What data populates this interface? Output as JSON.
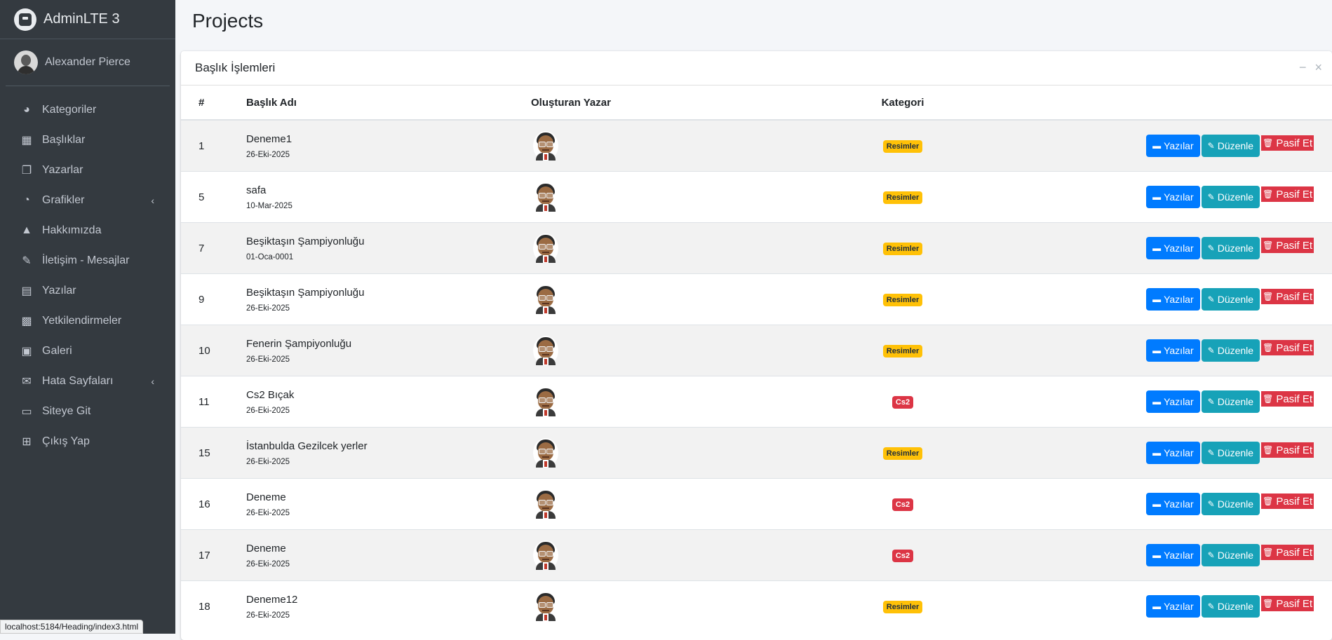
{
  "brand": {
    "name": "AdminLTE 3"
  },
  "user": {
    "name": "Alexander Pierce"
  },
  "sidebar": {
    "items": [
      {
        "label": "Kategoriler",
        "icon": "tachometer-icon",
        "glyph": "◕",
        "has_arrow": false
      },
      {
        "label": "Başlıklar",
        "icon": "grid-icon",
        "glyph": "▦",
        "has_arrow": false
      },
      {
        "label": "Yazarlar",
        "icon": "copy-icon",
        "glyph": "❐",
        "has_arrow": false
      },
      {
        "label": "Grafikler",
        "icon": "pie-chart-icon",
        "glyph": "◔",
        "has_arrow": true
      },
      {
        "label": "Hakkımızda",
        "icon": "tree-icon",
        "glyph": "▲",
        "has_arrow": false
      },
      {
        "label": "İletişim - Mesajlar",
        "icon": "edit-icon",
        "glyph": "✎",
        "has_arrow": false
      },
      {
        "label": "Yazılar",
        "icon": "table-icon",
        "glyph": "▤",
        "has_arrow": false
      },
      {
        "label": "Yetkilendirmeler",
        "icon": "calendar-icon",
        "glyph": "▩",
        "has_arrow": false
      },
      {
        "label": "Galeri",
        "icon": "image-icon",
        "glyph": "▣",
        "has_arrow": false
      },
      {
        "label": "Hata Sayfaları",
        "icon": "envelope-icon",
        "glyph": "✉",
        "has_arrow": true
      },
      {
        "label": "Siteye Git",
        "icon": "file-icon",
        "glyph": "▭",
        "has_arrow": false
      },
      {
        "label": "Çıkış Yap",
        "icon": "plus-square-icon",
        "glyph": "⊞",
        "has_arrow": false
      }
    ],
    "arrow_glyph": "‹"
  },
  "status_bar": {
    "url": "localhost:5184/Heading/index3.html"
  },
  "page": {
    "title": "Projects"
  },
  "card": {
    "title": "Başlık İşlemleri",
    "minimize_glyph": "−",
    "close_glyph": "×"
  },
  "table": {
    "headers": {
      "id": "#",
      "title": "Başlık Adı",
      "author": "Oluşturan Yazar",
      "category": "Kategori"
    },
    "rows": [
      {
        "id": "1",
        "title": "Deneme1",
        "date": "26-Eki-2025",
        "category": "Resimler",
        "category_color": "#ffc107"
      },
      {
        "id": "5",
        "title": "safa",
        "date": "10-Mar-2025",
        "category": "Resimler",
        "category_color": "#ffc107"
      },
      {
        "id": "7",
        "title": "Beşiktaşın Şampiyonluğu",
        "date": "01-Oca-0001",
        "category": "Resimler",
        "category_color": "#ffc107"
      },
      {
        "id": "9",
        "title": "Beşiktaşın Şampiyonluğu",
        "date": "26-Eki-2025",
        "category": "Resimler",
        "category_color": "#ffc107"
      },
      {
        "id": "10",
        "title": "Fenerin Şampiyonluğu",
        "date": "26-Eki-2025",
        "category": "Resimler",
        "category_color": "#ffc107"
      },
      {
        "id": "11",
        "title": "Cs2 Bıçak",
        "date": "26-Eki-2025",
        "category": "Cs2",
        "category_color": "#dc3545"
      },
      {
        "id": "15",
        "title": "İstanbulda Gezilcek yerler",
        "date": "26-Eki-2025",
        "category": "Resimler",
        "category_color": "#ffc107"
      },
      {
        "id": "16",
        "title": "Deneme",
        "date": "26-Eki-2025",
        "category": "Cs2",
        "category_color": "#dc3545"
      },
      {
        "id": "17",
        "title": "Deneme",
        "date": "26-Eki-2025",
        "category": "Cs2",
        "category_color": "#dc3545"
      },
      {
        "id": "18",
        "title": "Deneme12",
        "date": "26-Eki-2025",
        "category": "Resimler",
        "category_color": "#ffc107"
      }
    ],
    "actions": {
      "posts_label": "Yazılar",
      "posts_icon": "folder-icon",
      "posts_glyph": "▬",
      "edit_label": "Düzenle",
      "edit_icon": "pencil-icon",
      "edit_glyph": "✎",
      "deactivate_label": "Pasif Et",
      "deactivate_icon": "trash-icon",
      "deactivate_glyph": "🗑"
    }
  },
  "colors": {
    "sidebar_bg": "#343a40",
    "primary": "#007bff",
    "info": "#17a2b8",
    "danger": "#dc3545",
    "warning": "#ffc107"
  }
}
